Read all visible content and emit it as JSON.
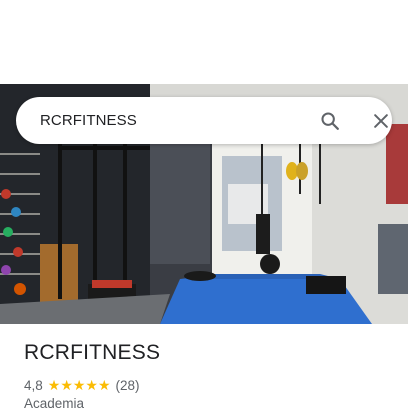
{
  "search": {
    "query": "RCRFITNESS"
  },
  "place": {
    "name": "RCRFITNESS",
    "rating": "4,8",
    "stars": "★★★★★",
    "reviews": "(28)",
    "category": "Academia"
  },
  "colors": {
    "star": "#fbbc04",
    "floor_mat": "#2f6fcf",
    "text_primary": "#202124",
    "text_secondary": "#5f6368"
  },
  "icons": {
    "search": "search-icon",
    "close": "close-icon",
    "star": "star-icon"
  }
}
